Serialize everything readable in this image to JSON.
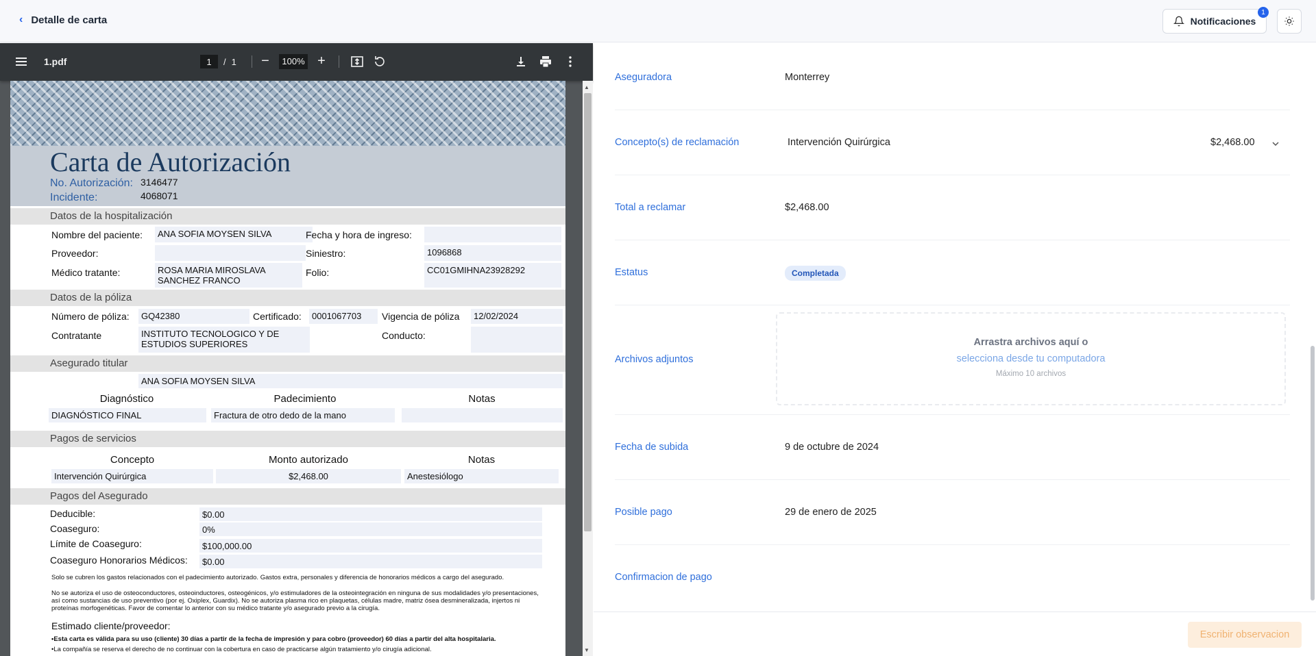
{
  "header": {
    "back_label": "Detalle de carta",
    "notifications_label": "Notificaciones",
    "notifications_count": "1"
  },
  "pdf_viewer": {
    "file_name": "1.pdf",
    "current_page": "1",
    "page_sep": "/",
    "total_pages": "1",
    "zoom": "100%"
  },
  "letter": {
    "title": "Carta de Autorización",
    "auth_label": "No. Autorización:",
    "auth_value": "3146477",
    "incident_label": "Incidente:",
    "incident_value": "4068071",
    "sec_hospital": "Datos de la hospitalización",
    "patient_label": "Nombre del paciente:",
    "patient_value": "ANA SOFIA MOYSEN SILVA",
    "admission_label": "Fecha y hora de ingreso:",
    "admission_value": "",
    "provider_label": "Proveedor:",
    "provider_value": "",
    "claim_label": "Siniestro:",
    "claim_value": "1096868",
    "doctor_label": "Médico tratante:",
    "doctor_value": "ROSA MARIA MIROSLAVA SANCHEZ FRANCO",
    "folio_label": "Folio:",
    "folio_value": "CC01GMIHNA23928292",
    "sec_policy": "Datos de la póliza",
    "policy_label": "Número de póliza:",
    "policy_value": "GQ42380",
    "cert_label": "Certificado:",
    "cert_value": "0001067703",
    "validity_label": "Vigencia de póliza",
    "validity_value": "12/02/2024",
    "contractor_label": "Contratante",
    "contractor_value": "INSTITUTO TECNOLOGICO Y DE ESTUDIOS SUPERIORES",
    "conduct_label": "Conducto:",
    "conduct_value": "",
    "sec_insured": "Asegurado titular",
    "insured_value": "ANA SOFIA MOYSEN SILVA",
    "diag_headers": [
      "Diagnóstico",
      "Padecimiento",
      "Notas"
    ],
    "diag_row": [
      "DIAGNÓSTICO FINAL",
      "Fractura de otro dedo de la mano",
      ""
    ],
    "sec_services": "Pagos de servicios",
    "svc_headers": [
      "Concepto",
      "Monto autorizado",
      "Notas"
    ],
    "svc_row": [
      "Intervención Quirúrgica",
      "$2,468.00",
      "Anestesiólogo"
    ],
    "sec_insured_pay": "Pagos del Asegurado",
    "deductible_label": "Deducible:",
    "deductible_value": "$0.00",
    "coinsurance_label": "Coaseguro:",
    "coinsurance_value": "0%",
    "coins_limit_label": "Límite de Coaseguro:",
    "coins_limit_value": "$100,000.00",
    "coins_fees_label": "Coaseguro Honorarios Médicos:",
    "coins_fees_value": "$0.00",
    "note1": "Solo se cubren los gastos relacionados con el padecimiento autorizado. Gastos extra, personales y diferencia de honorarios médicos a cargo del asegurado.",
    "note2": "No se autoriza el uso de osteoconductores, osteoinductores, osteogénicos, y/o estimuladores de la osteointegración en ninguna de sus modalidades y/o presentaciones, así como sustancias de uso preventivo (por ej. Oxiplex, Guardix). No se autoriza plasma rico en plaquetas, células madre, matriz ósea desmineralizada, injertos ni proteínas morfogenéticas. Favor de comentar lo anterior con su médico tratante y/o asegurado previo a la cirugía.",
    "estimate_label": "Estimado cliente/proveedor:",
    "bullet1": "•Esta carta es válida para su uso (cliente) 30 días a partir de la fecha de impresión y para cobro (proveedor) 60 días a partir del alta hospitalaria.",
    "bullet2": "•La compañía se reserva el derecho de no continuar con la cobertura en caso de practicarse algún tratamiento y/o cirugía adicional."
  },
  "details": {
    "insurer_label": "Aseguradora",
    "insurer_value": "Monterrey",
    "concepts_label": "Concepto(s) de reclamación",
    "concept_value": "Intervención Quirúrgica",
    "concept_amount": "$2,468.00",
    "total_label": "Total a reclamar",
    "total_value": "$2,468.00",
    "status_label": "Estatus",
    "status_value": "Completada",
    "attachments_label": "Archivos adjuntos",
    "drop_line1": "Arrastra archivos aquí o",
    "drop_link": "selecciona desde tu computadora",
    "drop_max": "Máximo 10 archivos",
    "upload_date_label": "Fecha de subida",
    "upload_date_value": "9 de octubre de 2024",
    "possible_payment_label": "Posible pago",
    "possible_payment_value": "29 de enero de 2025",
    "payment_confirmation_label": "Confirmacion de pago"
  },
  "footer": {
    "observation_button": "Escribir observacion"
  },
  "colors": {
    "accent": "#2f6fdb",
    "status_bg": "#e3ecfb",
    "observation_bg": "#fdeedd"
  }
}
